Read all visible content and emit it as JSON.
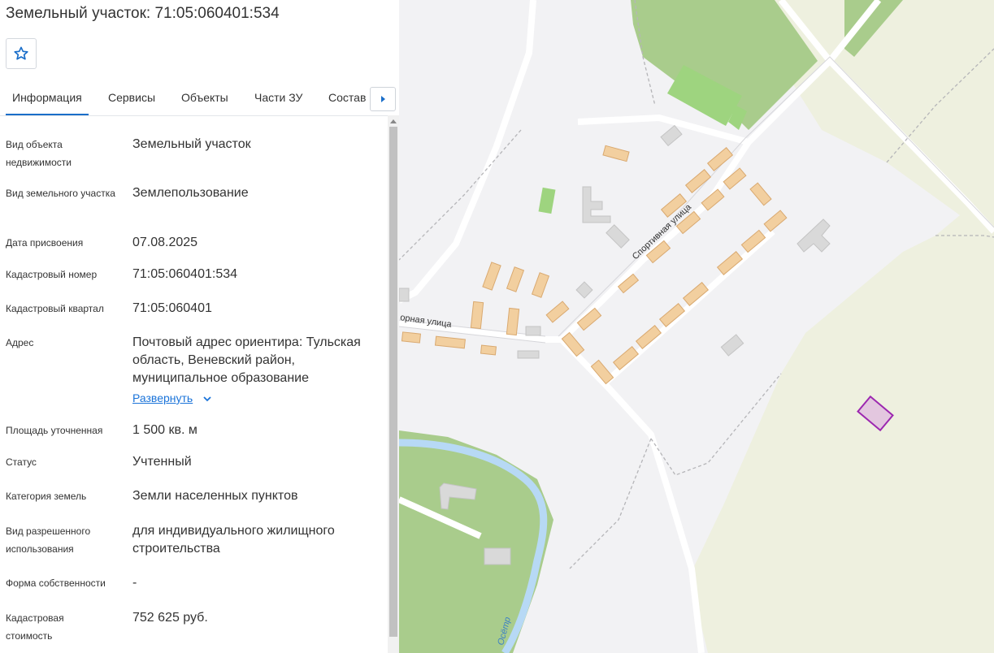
{
  "header": {
    "title": "Земельный участок: 71:05:060401:534"
  },
  "favorite": {
    "icon": "star-outline-icon"
  },
  "tabs": [
    {
      "label": "Информация",
      "active": true
    },
    {
      "label": "Сервисы"
    },
    {
      "label": "Объекты"
    },
    {
      "label": "Части ЗУ"
    },
    {
      "label": "Состав"
    }
  ],
  "tabs_next_icon": "caret-right-icon",
  "info": {
    "object_type": {
      "label": "Вид объекта недвижимости",
      "value": "Земельный участок"
    },
    "land_type": {
      "label": "Вид земельного участка",
      "value": "Землепользование"
    },
    "assign_date": {
      "label": "Дата присвоения",
      "value": "07.08.2025"
    },
    "cadastral_number": {
      "label": "Кадастровый номер",
      "value": "71:05:060401:534"
    },
    "cadastral_quarter": {
      "label": "Кадастровый квартал",
      "value": "71:05:060401"
    },
    "address": {
      "label": "Адрес",
      "value": "Почтовый адрес ориентира: Тульская область, Веневский район, муниципальное образование",
      "expand_label": "Развернуть"
    },
    "area": {
      "label": "Площадь уточненная",
      "value": "1 500 кв. м"
    },
    "status": {
      "label": "Статус",
      "value": "Учтенный"
    },
    "category": {
      "label": "Категория земель",
      "value": "Земли населенных пунктов"
    },
    "permitted_use": {
      "label": "Вид разрешенного использования",
      "value": "для индивидуального жилищного строительства"
    },
    "ownership": {
      "label": "Форма собственности",
      "value": "-"
    },
    "cadastral_cost": {
      "label": "Кадастровая стоимость",
      "value": "752 625 руб."
    }
  },
  "map": {
    "street_labels": [
      "Спортивная улица",
      "орная улица",
      "Осётр"
    ],
    "colors": {
      "background": "#f2f2f4",
      "forest": "#eef0df",
      "park": "#a9cc8c",
      "sport": "#9ed47f",
      "house": "#f2cf9f",
      "building": "#d9d9d9",
      "river": "#b7d9f5",
      "selected_parcel": "#9c27b0"
    }
  }
}
